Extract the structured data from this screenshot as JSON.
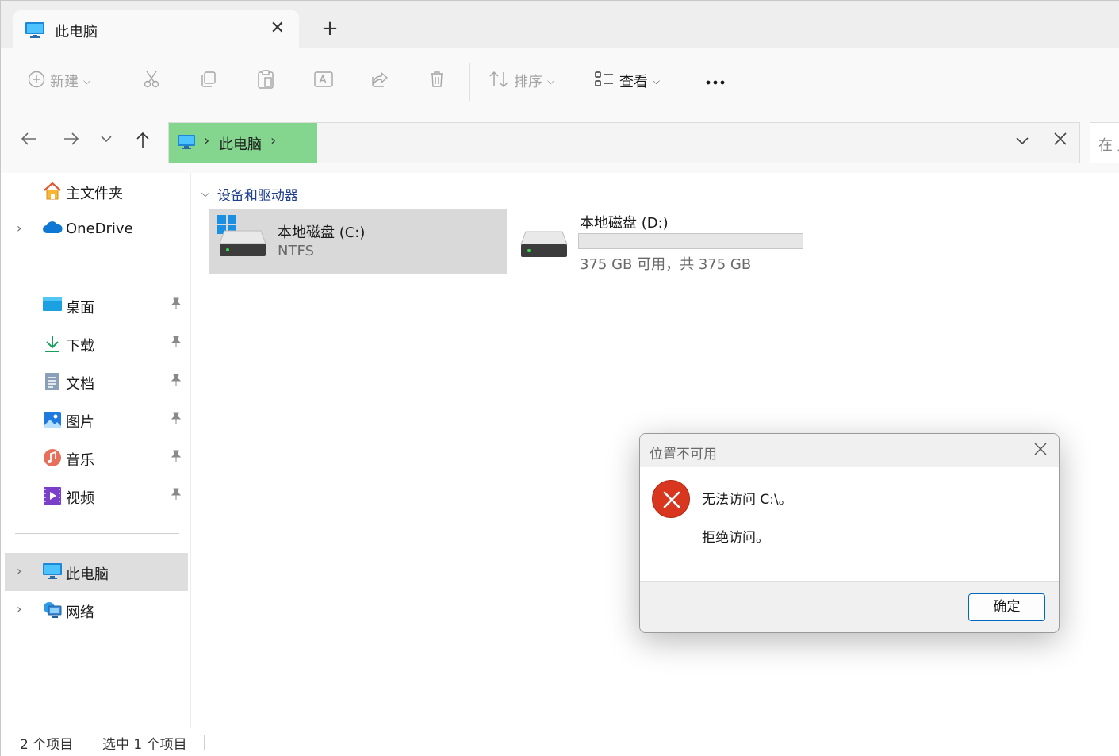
{
  "tab": {
    "title": "此电脑",
    "close": "✕",
    "new_tab": "+"
  },
  "toolbar": {
    "new_label": "新建",
    "sort_label": "排序",
    "view_label": "查看",
    "more": "•••"
  },
  "address": {
    "crumb": "此电脑",
    "separator": "›",
    "dropdown": "⌵",
    "clear": "✕",
    "search_placeholder": "在 此"
  },
  "nav": {
    "back": "←",
    "forward": "→",
    "recent": "⌵",
    "up": "↑"
  },
  "sidebar": {
    "home": "主文件夹",
    "onedrive": "OneDrive",
    "quick": [
      {
        "label": "桌面",
        "icon": "desktop-icon"
      },
      {
        "label": "下载",
        "icon": "download-icon"
      },
      {
        "label": "文档",
        "icon": "documents-icon"
      },
      {
        "label": "图片",
        "icon": "pictures-icon"
      },
      {
        "label": "音乐",
        "icon": "music-icon"
      },
      {
        "label": "视频",
        "icon": "videos-icon"
      }
    ],
    "this_pc": "此电脑",
    "network": "网络",
    "expander": "›",
    "pin": "📌"
  },
  "content": {
    "group_title": "设备和驱动器",
    "group_chevron": "⌵",
    "drives": [
      {
        "name": "本地磁盘 (C:)",
        "filesystem": "NTFS"
      },
      {
        "name": "本地磁盘 (D:)",
        "space": "375 GB 可用，共 375 GB",
        "used_fraction": 0.0
      }
    ]
  },
  "status": {
    "items": "2 个项目",
    "selected": "选中 1 个项目"
  },
  "dialog": {
    "title": "位置不可用",
    "close": "✕",
    "message": "无法访问 C:\\。",
    "detail": "拒绝访问。",
    "ok": "确定"
  },
  "colors": {
    "accent": "#0067c0",
    "breadcrumb_highlight": "#84d68f",
    "error": "#d8361e",
    "group_title": "#1f3f8f"
  }
}
